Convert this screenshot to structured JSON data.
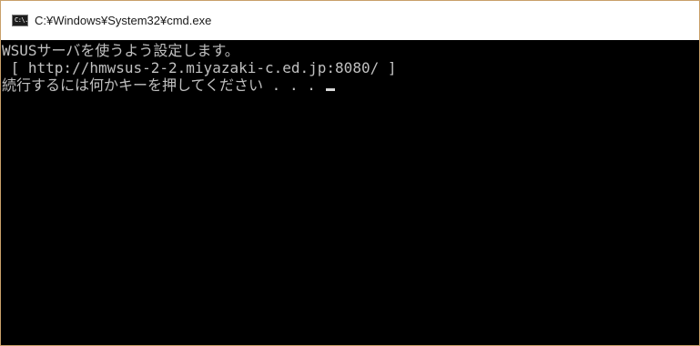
{
  "window": {
    "title": "C:¥Windows¥System32¥cmd.exe",
    "icon": "console-icon",
    "icon_text": "C:\\."
  },
  "console": {
    "lines": [
      "WSUSサーバを使うよう設定します。",
      " [ http://hmwsus-2-2.miyazaki-c.ed.jp:8080/ ]",
      "続行するには何かキーを押してください . . . "
    ]
  },
  "colors": {
    "console_bg": "#000000",
    "console_text": "#c0c0c0",
    "titlebar_bg": "#ffffff",
    "window_border": "#c9a06a"
  }
}
